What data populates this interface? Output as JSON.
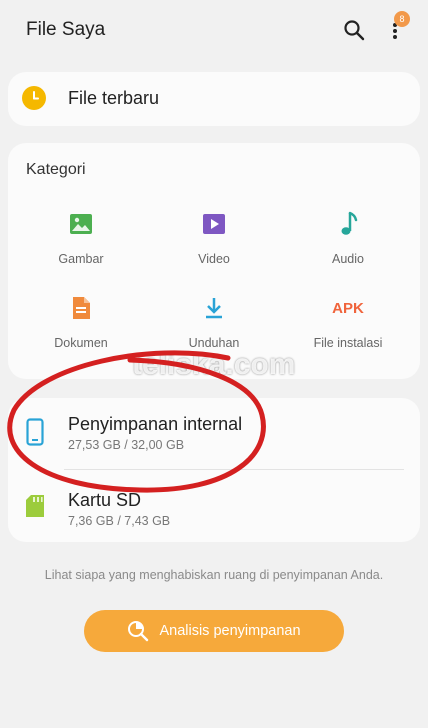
{
  "header": {
    "title": "File Saya",
    "notification_count": "8",
    "search_icon": "search-icon",
    "more_icon": "more-vert-icon"
  },
  "recent": {
    "label": "File terbaru",
    "icon": "clock-icon"
  },
  "categories": {
    "title": "Kategori",
    "items": [
      {
        "label": "Gambar",
        "icon": "image-icon",
        "color": "#4caf50"
      },
      {
        "label": "Video",
        "icon": "video-play-icon",
        "color": "#7e57c2"
      },
      {
        "label": "Audio",
        "icon": "music-note-icon",
        "color": "#26a69a"
      },
      {
        "label": "Dokumen",
        "icon": "document-icon",
        "color": "#f08a3c"
      },
      {
        "label": "Unduhan",
        "icon": "download-icon",
        "color": "#29a3d6"
      },
      {
        "label": "File instalasi",
        "icon": "apk-icon",
        "icon_text": "APK",
        "color": "#f0643c"
      }
    ]
  },
  "storage": [
    {
      "name": "Penyimpanan internal",
      "size": "27,53 GB / 32,00 GB",
      "icon": "phone-icon",
      "color": "#29a3d6"
    },
    {
      "name": "Kartu SD",
      "size": "7,36 GB / 7,43 GB",
      "icon": "sd-card-icon",
      "color": "#9ccc3c"
    }
  ],
  "hint": "Lihat siapa yang menghabiskan ruang di penyimpanan Anda.",
  "analyze_button": {
    "label": "Analisis penyimpanan",
    "icon": "storage-analysis-icon"
  },
  "watermark": "teliska.com",
  "colors": {
    "accent": "#f6a93b",
    "annotation": "#d42020",
    "clock": "#f5b800"
  }
}
